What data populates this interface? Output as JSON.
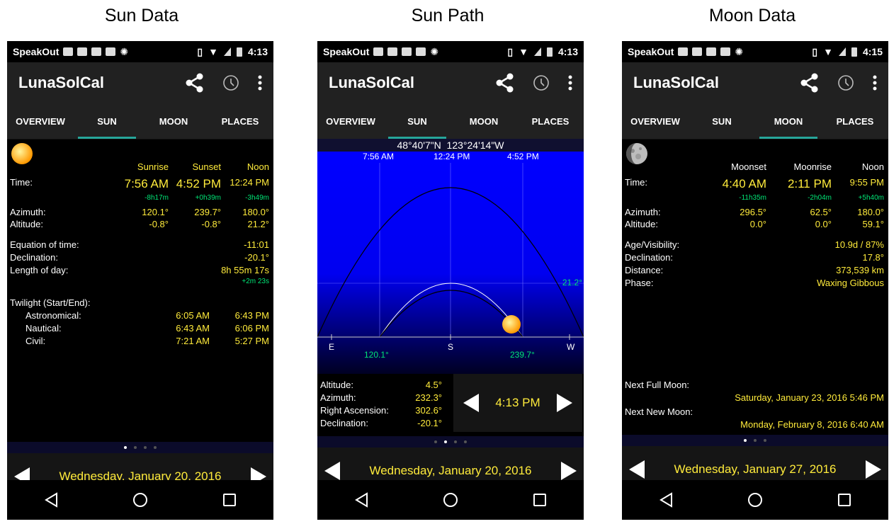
{
  "captions": [
    "Sun Data",
    "Sun Path",
    "Moon Data"
  ],
  "status": {
    "app": "SpeakOut",
    "time1": "4:13",
    "time2": "4:13",
    "time3": "4:15"
  },
  "appbar": {
    "title": "LunaSolCal"
  },
  "tabs": [
    "OVERVIEW",
    "SUN",
    "MOON",
    "PLACES"
  ],
  "sun": {
    "headers": [
      "Sunrise",
      "Sunset",
      "Noon"
    ],
    "time_label": "Time:",
    "times": [
      "7:56 AM",
      "4:52 PM",
      "12:24 PM"
    ],
    "deltas": [
      "-8h17m",
      "+0h39m",
      "-3h49m"
    ],
    "azimuth_label": "Azimuth:",
    "azimuth": [
      "120.1°",
      "239.7°",
      "180.0°"
    ],
    "altitude_label": "Altitude:",
    "altitude": [
      "-0.8°",
      "-0.8°",
      "21.2°"
    ],
    "eot_label": "Equation of time:",
    "eot": "-11:01",
    "decl_label": "Declination:",
    "decl": "-20.1°",
    "lod_label": "Length of day:",
    "lod": "8h 55m 17s",
    "lod_delta": "+2m 23s",
    "twilight_label": "Twilight (Start/End):",
    "twilight": [
      {
        "name": "Astronomical:",
        "start": "6:05 AM",
        "end": "6:43 PM"
      },
      {
        "name": "Nautical:",
        "start": "6:43 AM",
        "end": "6:06 PM"
      },
      {
        "name": "Civil:",
        "start": "7:21 AM",
        "end": "5:27 PM"
      }
    ],
    "date": "Wednesday, January 20, 2016"
  },
  "path": {
    "coords": "48°40'7\"N  123°24'14\"W",
    "top_times": [
      "7:56 AM",
      "12:24 PM",
      "4:52 PM"
    ],
    "max_alt": "21.2°",
    "compass": [
      "E",
      "S",
      "W"
    ],
    "rise_az": "120.1°",
    "set_az": "239.7°",
    "info": [
      {
        "label": "Altitude:",
        "value": "4.5°"
      },
      {
        "label": "Azimuth:",
        "value": "232.3°"
      },
      {
        "label": "Right Ascension:",
        "value": "302.6°"
      },
      {
        "label": "Declination:",
        "value": "-20.1°"
      }
    ],
    "current_time": "4:13 PM",
    "date": "Wednesday, January 20, 2016"
  },
  "moon": {
    "headers": [
      "Moonset",
      "Moonrise",
      "Noon"
    ],
    "time_label": "Time:",
    "times": [
      "4:40 AM",
      "2:11 PM",
      "9:55 PM"
    ],
    "deltas": [
      "-11h35m",
      "-2h04m",
      "+5h40m"
    ],
    "azimuth_label": "Azimuth:",
    "azimuth": [
      "296.5°",
      "62.5°",
      "180.0°"
    ],
    "altitude_label": "Altitude:",
    "altitude": [
      "0.0°",
      "0.0°",
      "59.1°"
    ],
    "age_label": "Age/Visibility:",
    "age": "10.9d / 87%",
    "decl_label": "Declination:",
    "decl": "17.8°",
    "dist_label": "Distance:",
    "dist": "373,539 km",
    "phase_label": "Phase:",
    "phase": "Waxing Gibbous",
    "next_full_label": "Next Full Moon:",
    "next_full": "Saturday, January 23, 2016 5:46 PM",
    "next_new_label": "Next New Moon:",
    "next_new": "Monday, February 8, 2016 6:40 AM",
    "date": "Wednesday, January 27, 2016"
  },
  "colors": {
    "accent": "#26a69a",
    "value": "#ffeb3b",
    "delta": "#00e676",
    "sky": "#0000ff"
  }
}
